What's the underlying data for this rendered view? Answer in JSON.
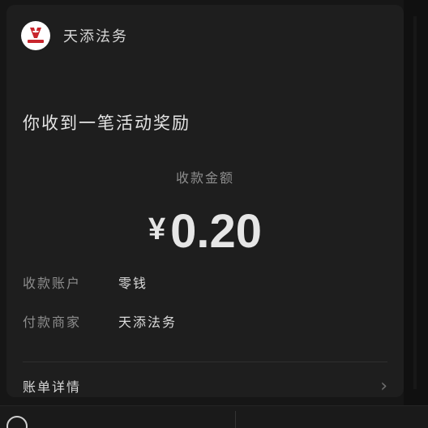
{
  "merchant": {
    "name": "天添法务",
    "logo_icon": "merchant-logo-icon",
    "logo_colors": [
      "#c8252c",
      "#ffffff"
    ]
  },
  "notice": {
    "headline": "你收到一笔活动奖励"
  },
  "payment": {
    "amount_label": "收款金额",
    "currency_symbol": "¥",
    "amount": "0.20"
  },
  "details": [
    {
      "label": "收款账户",
      "value": "零钱"
    },
    {
      "label": "付款商家",
      "value": "天添法务"
    }
  ],
  "bill": {
    "label": "账单详情",
    "chevron_icon": "chevron-right-icon"
  },
  "colors": {
    "background": "#161616",
    "card": "#1e1e1e",
    "text_primary": "#e4e4e4",
    "text_secondary": "#8c8c8c"
  }
}
